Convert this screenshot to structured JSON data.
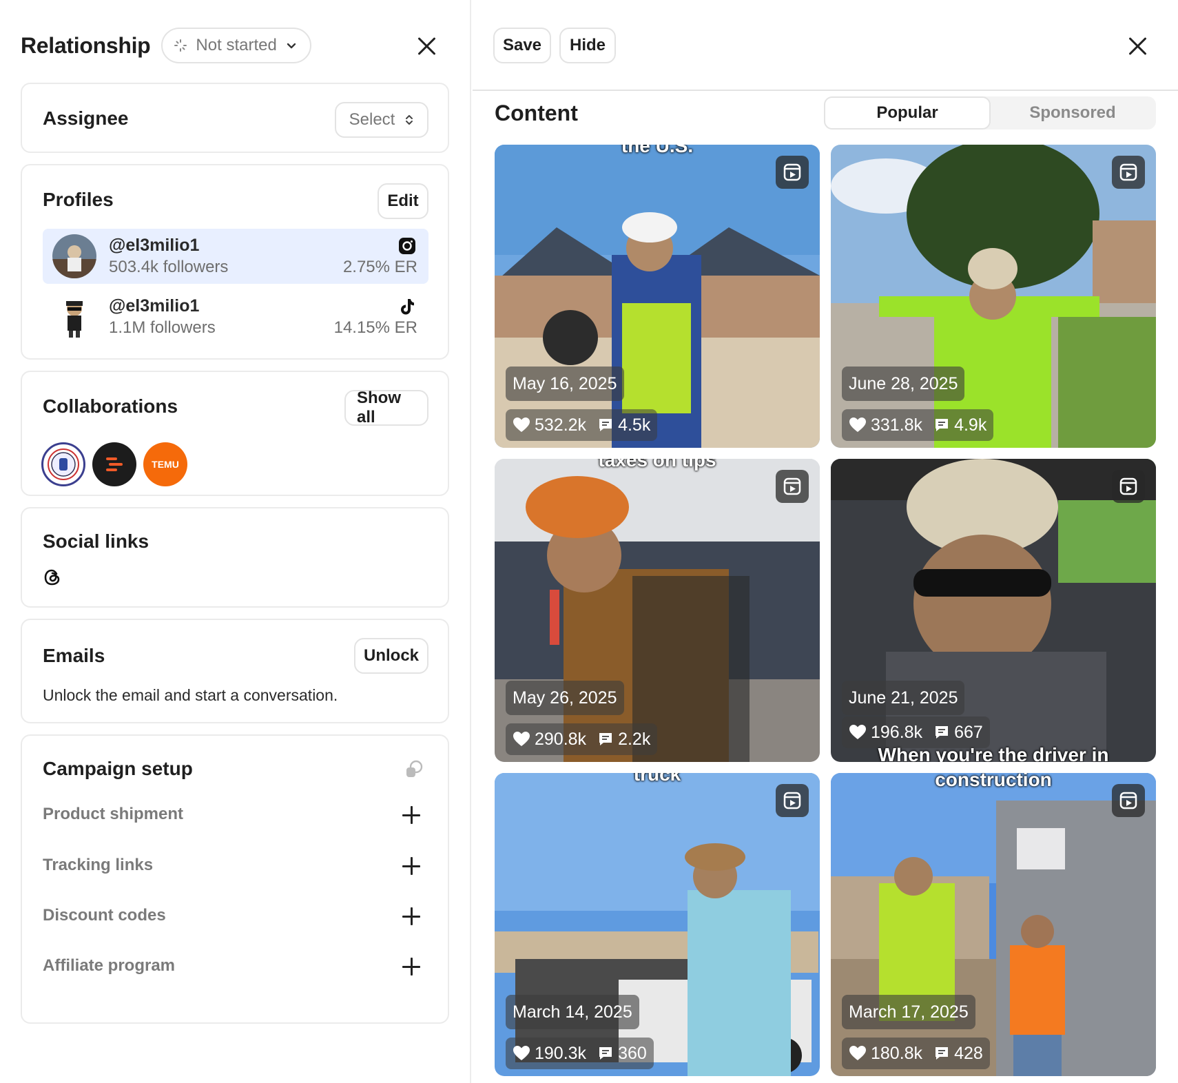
{
  "left": {
    "title": "Relationship",
    "status": "Not started",
    "assignee": {
      "title": "Assignee",
      "select_label": "Select"
    },
    "profiles": {
      "title": "Profiles",
      "edit_label": "Edit",
      "items": [
        {
          "handle": "@el3milio1",
          "followers": "503.4k followers",
          "er": "2.75% ER",
          "platform": "instagram-icon"
        },
        {
          "handle": "@el3milio1",
          "followers": "1.1M followers",
          "er": "14.15% ER",
          "platform": "tiktok-icon"
        }
      ]
    },
    "collaborations": {
      "title": "Collaborations",
      "show_all_label": "Show all",
      "temu_text": "TEMU"
    },
    "social_links": {
      "title": "Social links",
      "icon": "threads-icon"
    },
    "emails": {
      "title": "Emails",
      "unlock_label": "Unlock",
      "body": "Unlock the email and start a conversation."
    },
    "campaign_setup": {
      "title": "Campaign setup",
      "items": [
        "Product shipment",
        "Tracking links",
        "Discount codes",
        "Affiliate program"
      ]
    }
  },
  "right": {
    "save_label": "Save",
    "hide_label": "Hide",
    "content_title": "Content",
    "tabs": [
      "Popular",
      "Sponsored"
    ],
    "posts": [
      {
        "date": "May 16, 2025",
        "likes": "532.2k",
        "comments": "4.5k",
        "caption_top": "the U.S.",
        "caption_bottom": ""
      },
      {
        "date": "June 28, 2025",
        "likes": "331.8k",
        "comments": "4.9k",
        "caption_top": "",
        "caption_bottom": ""
      },
      {
        "date": "May 26, 2025",
        "likes": "290.8k",
        "comments": "2.2k",
        "caption_top": "taxes on tips",
        "caption_bottom": ""
      },
      {
        "date": "June 21, 2025",
        "likes": "196.8k",
        "comments": "667",
        "caption_top": "",
        "caption_bottom": "When you're the driver in"
      },
      {
        "date": "March 14, 2025",
        "likes": "190.3k",
        "comments": "360",
        "caption_top": "truck",
        "caption_bottom": ""
      },
      {
        "date": "March 17, 2025",
        "likes": "180.8k",
        "comments": "428",
        "caption_top": "construction",
        "caption_bottom": ""
      }
    ]
  },
  "colors": {
    "accent_bg": "#e8efff",
    "border": "#ebebeb",
    "temu_orange": "#f56a0a"
  }
}
